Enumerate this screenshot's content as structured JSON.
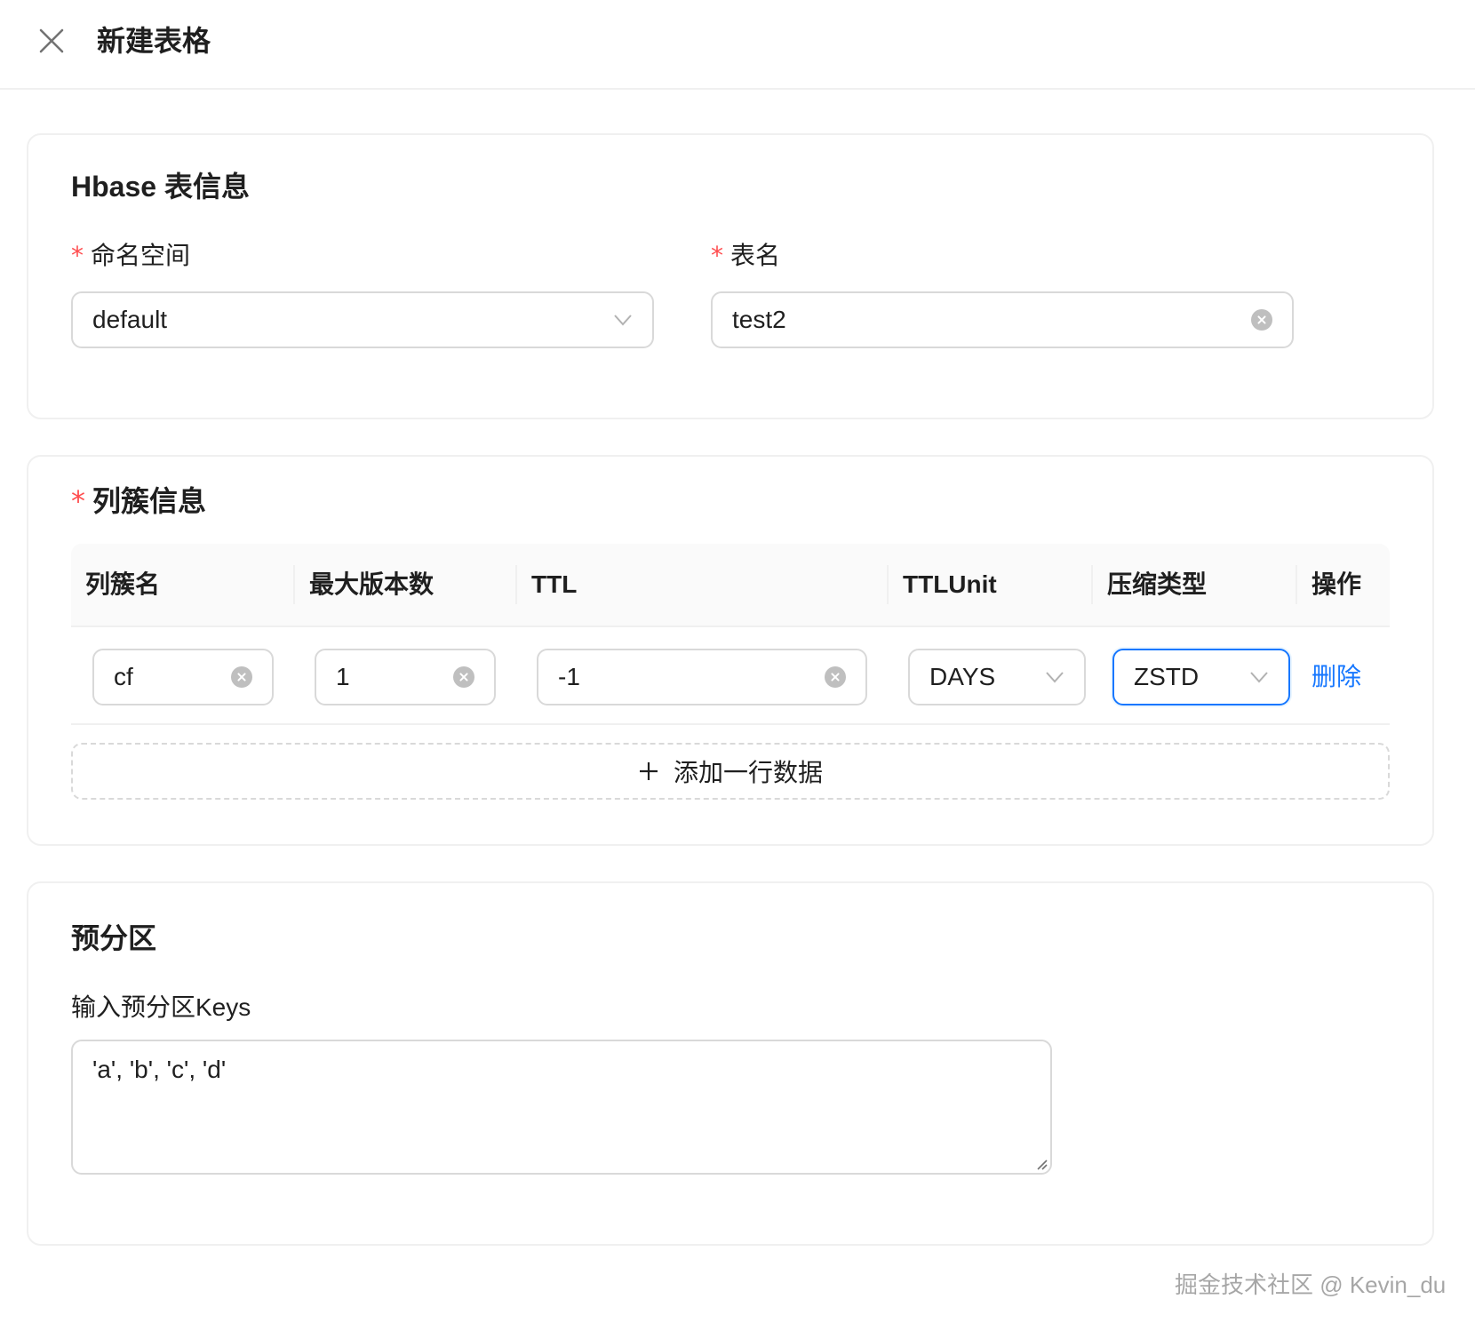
{
  "header": {
    "title": "新建表格"
  },
  "hbase_card": {
    "title": "Hbase 表信息",
    "namespace": {
      "required_mark": "*",
      "label": "命名空间",
      "value": "default"
    },
    "table_name": {
      "required_mark": "*",
      "label": "表名",
      "value": "test2"
    }
  },
  "cf_card": {
    "required_mark": "*",
    "title": "列簇信息",
    "columns": [
      "列簇名",
      "最大版本数",
      "TTL",
      "TTLUnit",
      "压缩类型",
      "操作"
    ],
    "rows": [
      {
        "name": "cf",
        "max_versions": "1",
        "ttl": "-1",
        "ttl_unit": "DAYS",
        "compression": "ZSTD",
        "action": "删除"
      }
    ],
    "add_row_label": "添加一行数据"
  },
  "presplit_card": {
    "title": "预分区",
    "label": "输入预分区Keys",
    "value": "'a', 'b', 'c', 'd'"
  },
  "watermark": "掘金技术社区 @ Kevin_du",
  "colors": {
    "primary": "#1677ff",
    "required": "#ff4d4f",
    "border": "#d9d9d9"
  }
}
